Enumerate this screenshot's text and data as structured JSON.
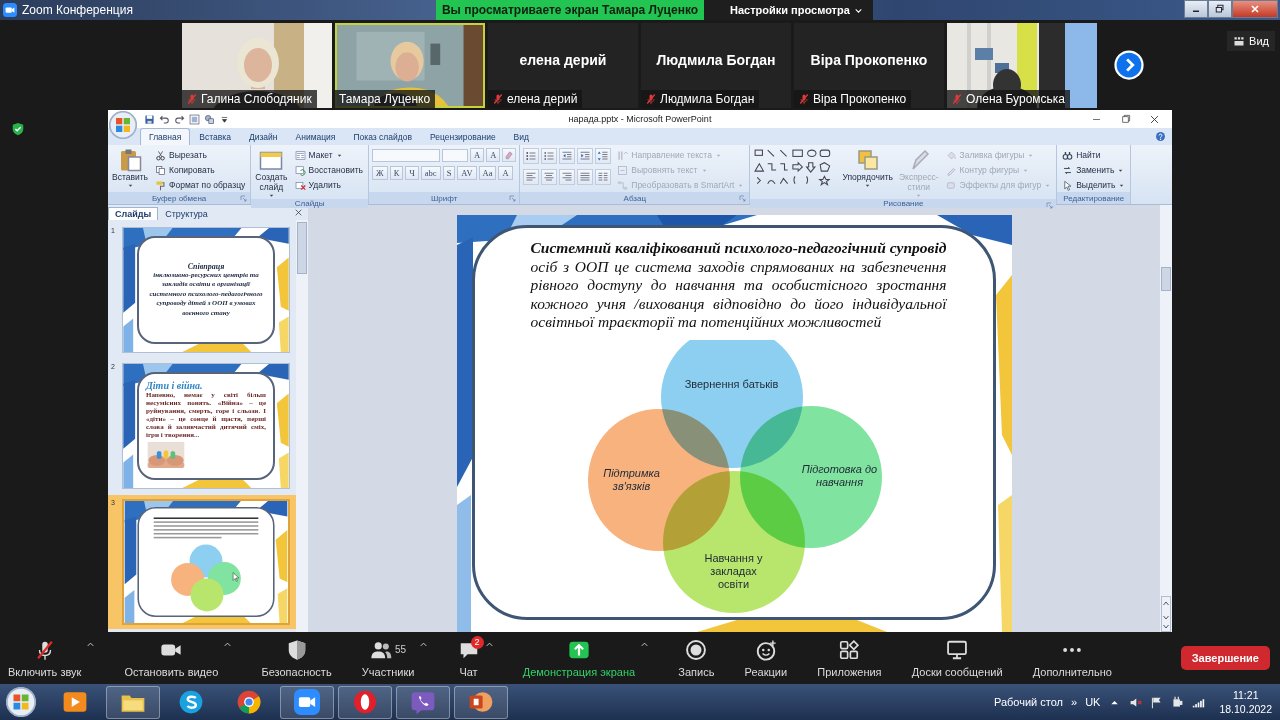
{
  "zoom_window": {
    "title": "Zoom Конференция",
    "sharing_banner": "Вы просматриваете экран Тамара Луценко",
    "view_options": "Настройки просмотра",
    "view_button": "Вид"
  },
  "participants": [
    {
      "name": "Галина Слободяник",
      "video": true,
      "muted": true,
      "speaking": false
    },
    {
      "name": "Тамара Луценко",
      "video": true,
      "muted": false,
      "speaking": true
    },
    {
      "name": "елена дерий",
      "display_name": "елена дерий",
      "video": false,
      "muted": true,
      "speaking": false
    },
    {
      "name": "Людмила Богдан",
      "display_name": "Людмила Богдан",
      "video": false,
      "muted": true,
      "speaking": false
    },
    {
      "name": "Віра Прокопенко",
      "display_name": "Віра Прокопенко",
      "video": false,
      "muted": true,
      "speaking": false
    },
    {
      "name": "Олена Буромська",
      "video": true,
      "muted": true,
      "speaking": false
    }
  ],
  "powerpoint": {
    "title": "нарада.pptx - Microsoft PowerPoint",
    "tabs": [
      {
        "label": "Главная",
        "selected": true
      },
      {
        "label": "Вставка",
        "selected": false
      },
      {
        "label": "Дизайн",
        "selected": false
      },
      {
        "label": "Анимация",
        "selected": false
      },
      {
        "label": "Показ слайдов",
        "selected": false
      },
      {
        "label": "Рецензирование",
        "selected": false
      },
      {
        "label": "Вид",
        "selected": false
      }
    ],
    "ribbon_groups": [
      {
        "title": "Буфер обмена",
        "launcher": true,
        "parts": [
          {
            "kind": "paste",
            "label": "Вставить",
            "menu": true,
            "disabled": false
          },
          {
            "kind": "column",
            "items": [
              {
                "kind": "cut",
                "label": "Вырезать",
                "menu": false,
                "disabled": false
              },
              {
                "kind": "copy",
                "label": "Копировать",
                "menu": false,
                "disabled": false
              },
              {
                "kind": "brush",
                "label": "Формат по образцу",
                "menu": false,
                "disabled": false
              }
            ]
          }
        ]
      },
      {
        "title": "Слайды",
        "launcher": false,
        "parts": [
          {
            "kind": "newslide",
            "label": "Создать слайд",
            "menu": true,
            "disabled": false
          },
          {
            "kind": "column",
            "items": [
              {
                "kind": "layout",
                "label": "Макет",
                "menu": true,
                "disabled": false
              },
              {
                "kind": "reset",
                "label": "Восстановить",
                "menu": false,
                "disabled": false
              },
              {
                "kind": "delete",
                "label": "Удалить",
                "menu": false,
                "disabled": false
              }
            ]
          }
        ]
      },
      {
        "title": "Шрифт",
        "launcher": true,
        "parts": [
          {
            "kind": "font",
            "size_buttons": [
              "A",
              "A"
            ],
            "style_buttons": [
              "Ж",
              "К",
              "Ч",
              "abc",
              "S",
              "AV",
              "Aa",
              "A"
            ]
          }
        ]
      },
      {
        "title": "Абзац",
        "launcher": true,
        "parts": [
          {
            "kind": "paragraph"
          },
          {
            "kind": "column",
            "items": [
              {
                "kind": "textdir",
                "label": "Направление текста",
                "menu": true,
                "disabled": true
              },
              {
                "kind": "aligntext",
                "label": "Выровнять текст",
                "menu": true,
                "disabled": true
              },
              {
                "kind": "smartart",
                "label": "Преобразовать в SmartArt",
                "menu": true,
                "disabled": true
              }
            ]
          }
        ]
      },
      {
        "title": "Рисование",
        "launcher": true,
        "parts": [
          {
            "kind": "shapes"
          },
          {
            "kind": "arrange",
            "label": "Упорядочить",
            "menu": true,
            "disabled": false
          },
          {
            "kind": "styles",
            "label": "Экспресс-стили",
            "menu": true,
            "disabled": true
          },
          {
            "kind": "column",
            "items": [
              {
                "kind": "fill",
                "label": "Заливка фигуры",
                "menu": true,
                "disabled": true
              },
              {
                "kind": "outline",
                "label": "Контур фигуры",
                "menu": true,
                "disabled": true
              },
              {
                "kind": "effects",
                "label": "Эффекты для фигур",
                "menu": true,
                "disabled": true
              }
            ]
          }
        ]
      },
      {
        "title": "Редактирование",
        "launcher": false,
        "parts": [
          {
            "kind": "column",
            "items": [
              {
                "kind": "find",
                "label": "Найти",
                "menu": false,
                "disabled": false
              },
              {
                "kind": "replace",
                "label": "Заменить",
                "menu": true,
                "disabled": false
              },
              {
                "kind": "select",
                "label": "Выделить",
                "menu": true,
                "disabled": false
              }
            ]
          }
        ]
      }
    ],
    "slides_pane": {
      "tabs": [
        {
          "label": "Слайды",
          "selected": true
        },
        {
          "label": "Структура",
          "selected": false
        }
      ],
      "slides": [
        {
          "number": "1",
          "kind": "title",
          "selected": false,
          "title": "Співпраця",
          "subtitle": "інклюзивно-ресурсних центрів та закладів освіти в організації системного психолого-педагогічного супроводу дітей з ООП в умовах воєнного стану"
        },
        {
          "number": "2",
          "kind": "text",
          "selected": false,
          "heading": "Діти і війна.",
          "body": "Напевно, немає у світі більш несумісних понять. «Війна» – це руйнування, смерть, горе і сльози. І «діти» – це сонце й щастя, перші слова й заливчастий дитячий сміх, ігри і творення..."
        },
        {
          "number": "3",
          "kind": "diagram",
          "selected": true
        }
      ]
    },
    "slide": {
      "text": "**Системний кваліфікований психолого-педагогічний супровід** осіб з ООП це система заходів спрямованих на забезпечення рівного доступу до навчання та особистісного зростання кожного учня /вихованця відповідно до його індивідуальної освітньої траєкторії та потенційних можливостей",
      "venn": [
        {
          "label": "Звернення батьків",
          "italic": false,
          "color": "#8ccff0"
        },
        {
          "label": "Підтримка зв'язків",
          "italic": true,
          "color": "#f8b27e"
        },
        {
          "label": "Підготовка до навчання",
          "italic": true,
          "color": "#80e3a0"
        },
        {
          "label": "Навчання у закладах освіти",
          "italic": false,
          "color": "#b8e66c"
        }
      ]
    }
  },
  "meeting_controls": [
    {
      "kind": "unmute",
      "label": "Включить звук",
      "menu": true
    },
    {
      "kind": "video",
      "label": "Остановить видео",
      "menu": true
    },
    {
      "kind": "security",
      "label": "Безопасность",
      "menu": false
    },
    {
      "kind": "participants",
      "label": "Участники",
      "count": "55",
      "menu": true
    },
    {
      "kind": "chat",
      "label": "Чат",
      "badge": "2",
      "menu": true
    },
    {
      "kind": "share",
      "label": "Демонстрация экрана",
      "menu": true
    },
    {
      "kind": "record",
      "label": "Запись",
      "menu": false
    },
    {
      "kind": "reactions",
      "label": "Реакции",
      "menu": false
    },
    {
      "kind": "apps",
      "label": "Приложения",
      "menu": false
    },
    {
      "kind": "whiteboards",
      "label": "Доски сообщений",
      "menu": false
    },
    {
      "kind": "more",
      "label": "Дополнительно",
      "menu": false
    }
  ],
  "end_button": "Завершение",
  "taskbar": {
    "apps": [
      {
        "kind": "media",
        "running": false
      },
      {
        "kind": "folder",
        "running": true
      },
      {
        "kind": "skype",
        "running": false
      },
      {
        "kind": "chrome",
        "running": false
      },
      {
        "kind": "zoom",
        "running": true
      },
      {
        "kind": "opera",
        "running": true
      },
      {
        "kind": "viber",
        "running": true
      },
      {
        "kind": "powerpoint",
        "running": true
      }
    ],
    "desktop_toolbar": "Рабочий стол",
    "expand": "»",
    "language": "UK",
    "time": "11:21",
    "date": "18.10.2022"
  }
}
